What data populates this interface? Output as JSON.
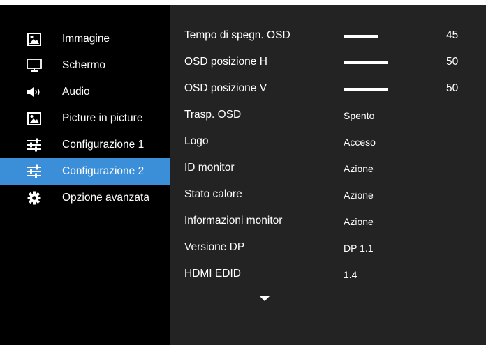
{
  "sidebar": {
    "items": [
      {
        "label": "Immagine",
        "icon": "picture-icon",
        "active": false
      },
      {
        "label": "Schermo",
        "icon": "monitor-icon",
        "active": false
      },
      {
        "label": "Audio",
        "icon": "speaker-icon",
        "active": false
      },
      {
        "label": "Picture in picture",
        "icon": "picture-icon",
        "active": false
      },
      {
        "label": "Configurazione 1",
        "icon": "sliders-icon",
        "active": false
      },
      {
        "label": "Configurazione 2",
        "icon": "sliders-icon",
        "active": true
      },
      {
        "label": "Opzione avanzata",
        "icon": "gear-icon",
        "active": false
      }
    ]
  },
  "settings": {
    "rows": [
      {
        "label": "Tempo di spegn. OSD",
        "type": "slider",
        "value": "45",
        "level": 0.45
      },
      {
        "label": "OSD posizione H",
        "type": "slider",
        "value": "50",
        "level": 0.5
      },
      {
        "label": "OSD posizione V",
        "type": "slider",
        "value": "50",
        "level": 0.5
      },
      {
        "label": "Trasp. OSD",
        "type": "text",
        "value": "Spento"
      },
      {
        "label": "Logo",
        "type": "text",
        "value": "Acceso"
      },
      {
        "label": "ID monitor",
        "type": "text",
        "value": "Azione"
      },
      {
        "label": "Stato calore",
        "type": "text",
        "value": "Azione"
      },
      {
        "label": "Informazioni monitor",
        "type": "text",
        "value": "Azione"
      },
      {
        "label": "Versione DP",
        "type": "text",
        "value": "DP 1.1"
      },
      {
        "label": "HDMI EDID",
        "type": "text",
        "value": "1.4"
      }
    ],
    "more_icon": "chevron-down-icon"
  },
  "colors": {
    "sidebar_bg": "#000000",
    "content_bg": "#232323",
    "active_bg": "#3b8ed8",
    "text": "#ffffff"
  }
}
